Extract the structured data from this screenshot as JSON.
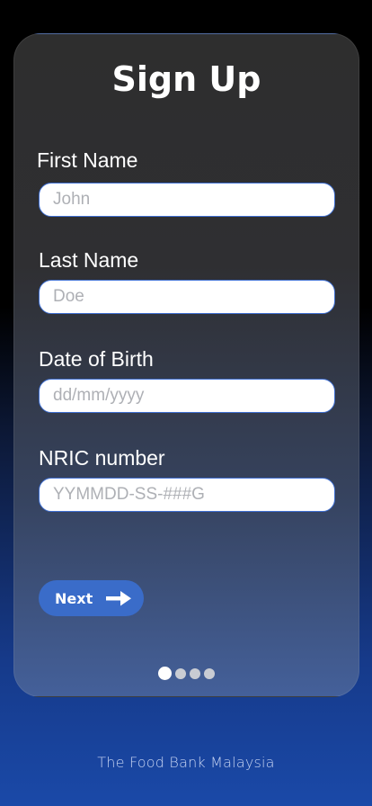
{
  "title": "Sign Up",
  "fields": {
    "first_name": {
      "label": "First Name",
      "placeholder": "John",
      "value": ""
    },
    "last_name": {
      "label": "Last Name",
      "placeholder": "Doe",
      "value": ""
    },
    "dob": {
      "label": "Date of Birth",
      "placeholder": "dd/mm/yyyy",
      "value": ""
    },
    "nric": {
      "label": "NRIC number",
      "placeholder": "YYMMDD-SS-###G",
      "value": ""
    }
  },
  "next_button": {
    "label": "Next",
    "icon": "arrow-right-icon"
  },
  "pagination": {
    "total": 4,
    "active": 1
  },
  "footer": "The Food Bank Malaysia",
  "colors": {
    "accent": "#3a6cc9",
    "input_border": "#3f6fd1"
  }
}
